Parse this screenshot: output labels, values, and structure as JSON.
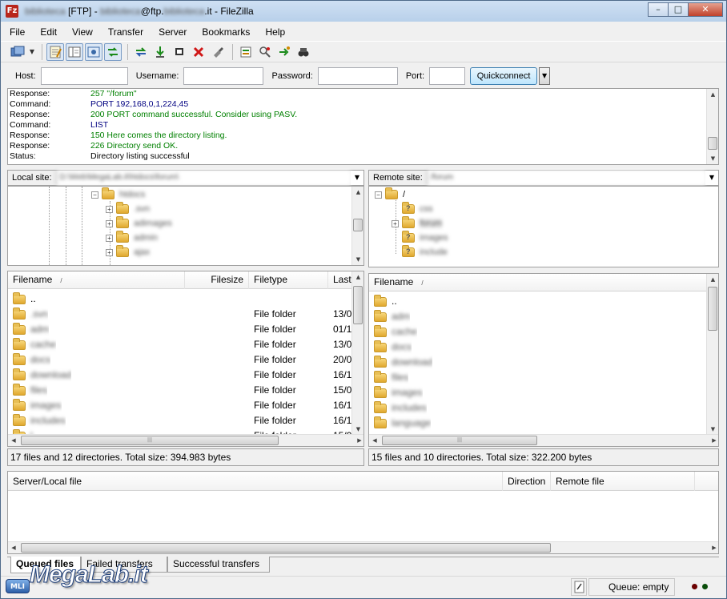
{
  "window": {
    "title_prefix": "[FTP] -",
    "title_blur1": "biblioteca",
    "title_user_blur": "biblioteca",
    "title_host_mid": "@ftp.",
    "title_host_blur": "biblioteca",
    "title_suffix": ".it - FileZilla",
    "app_icon": "Fz",
    "minimize": "–",
    "maximize": "□",
    "close": "✕"
  },
  "menu": [
    "File",
    "Edit",
    "View",
    "Transfer",
    "Server",
    "Bookmarks",
    "Help"
  ],
  "toolbar_icons": [
    "site-manager-icon",
    "dropdown-arrow-icon",
    "toggle-log-icon",
    "toggle-tree-icon",
    "toggle-remote-tree-icon",
    "toggle-queue-icon",
    "refresh-icon",
    "process-queue-icon",
    "stop-icon",
    "disconnect-icon",
    "reconnect-icon",
    "directory-compare-icon",
    "filter-icon",
    "sync-browse-icon",
    "search-icon"
  ],
  "quickconnect": {
    "host_label": "Host:",
    "username_label": "Username:",
    "password_label": "Password:",
    "port_label": "Port:",
    "host_value": "",
    "username_value": "",
    "password_value": "",
    "port_value": "",
    "button_label": "Quickconnect",
    "dropdown": "▼"
  },
  "log": [
    {
      "type": "Response:",
      "text": "257 \"/forum\"",
      "color": "#008000"
    },
    {
      "type": "Command:",
      "text": "PORT 192,168,0,1,224,45",
      "color": "#000080"
    },
    {
      "type": "Response:",
      "text": "200 PORT command successful. Consider using PASV.",
      "color": "#008000"
    },
    {
      "type": "Command:",
      "text": "LIST",
      "color": "#000080"
    },
    {
      "type": "Response:",
      "text": "150 Here comes the directory listing.",
      "color": "#008000"
    },
    {
      "type": "Response:",
      "text": "226 Directory send OK.",
      "color": "#008000"
    },
    {
      "type": "Status:",
      "text": "Directory listing successful",
      "color": "#000000"
    }
  ],
  "local": {
    "site_label": "Local site:",
    "path": "D:\\Web\\MegaLab.it\\htdocs\\forum\\",
    "tree": [
      {
        "name": "htdocs",
        "expander": "−"
      },
      {
        "name": ".svn",
        "expander": "+"
      },
      {
        "name": "adimages",
        "expander": "+"
      },
      {
        "name": "admin",
        "expander": "+"
      },
      {
        "name": "ajax",
        "expander": "+"
      }
    ],
    "columns": {
      "filename": "Filename",
      "sort": "/",
      "filesize": "Filesize",
      "filetype": "Filetype",
      "last": "Last"
    },
    "files": [
      {
        "name": "..",
        "type": "",
        "date": ""
      },
      {
        "name": ".svn",
        "type": "File folder",
        "date": "13/0"
      },
      {
        "name": "adm",
        "type": "File folder",
        "date": "01/1"
      },
      {
        "name": "cache",
        "type": "File folder",
        "date": "13/0"
      },
      {
        "name": "docs",
        "type": "File folder",
        "date": "20/0"
      },
      {
        "name": "download",
        "type": "File folder",
        "date": "16/1"
      },
      {
        "name": "files",
        "type": "File folder",
        "date": "15/0"
      },
      {
        "name": "images",
        "type": "File folder",
        "date": "16/1"
      },
      {
        "name": "includes",
        "type": "File folder",
        "date": "16/1"
      },
      {
        "name": "l...",
        "type": "File folder",
        "date": "15/0"
      }
    ],
    "status": "17 files and 12 directories. Total size: 394.983 bytes"
  },
  "remote": {
    "site_label": "Remote site:",
    "path": "/forum",
    "tree": [
      {
        "name": "/",
        "expander": "−",
        "q": false
      },
      {
        "name": "css",
        "expander": "",
        "q": true
      },
      {
        "name": "forum",
        "expander": "+",
        "q": false
      },
      {
        "name": "images",
        "expander": "",
        "q": true
      },
      {
        "name": "include",
        "expander": "",
        "q": true
      }
    ],
    "columns": {
      "filename": "Filename",
      "sort": "/"
    },
    "files": [
      {
        "name": ".."
      },
      {
        "name": "adm"
      },
      {
        "name": "cache"
      },
      {
        "name": "docs"
      },
      {
        "name": "download"
      },
      {
        "name": "files"
      },
      {
        "name": "images"
      },
      {
        "name": "includes"
      },
      {
        "name": "language"
      }
    ],
    "status": "15 files and 10 directories. Total size: 322.200 bytes"
  },
  "queue": {
    "columns": {
      "server_local": "Server/Local file",
      "direction": "Direction",
      "remote": "Remote file"
    },
    "tabs": [
      "Queued files",
      "Failed transfers",
      "Successful transfers"
    ]
  },
  "statusbar": {
    "queue": "Queue: empty",
    "led_colors": [
      "#6b0000",
      "#0a4d0a"
    ]
  },
  "watermark": {
    "text": "MegaLab.it",
    "badge": "MLI"
  }
}
